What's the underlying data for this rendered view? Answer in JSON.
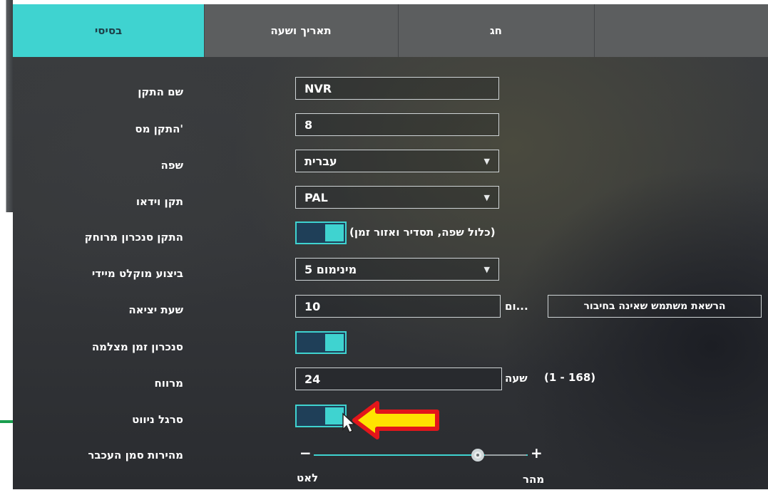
{
  "tabs": [
    {
      "label": "בסיסי",
      "active": true
    },
    {
      "label": "תאריך ושעה",
      "active": false
    },
    {
      "label": "חג",
      "active": false
    },
    {
      "label": "",
      "active": false
    }
  ],
  "rows": {
    "device_name": {
      "label": "שם התקן",
      "value": "NVR"
    },
    "device_no": {
      "label": "'התקן מס",
      "value": "8"
    },
    "language": {
      "label": "שפה",
      "value": "עברית"
    },
    "video_standard": {
      "label": "תקן וידאו",
      "value": "PAL"
    },
    "remote_sync": {
      "label": "התקן סנכרון מרוחק",
      "note": "(כלול שפה, תסדיר ואזור זמן)",
      "on": true
    },
    "instant_playback": {
      "label": "ביצוע מוקלט מיידי",
      "value": "מינימום 5"
    },
    "logout_time": {
      "label": "שעת יציאה",
      "value": "10",
      "unit": "...ום",
      "button": "הרשאת משתמש שאינה בחיבור"
    },
    "camera_time_sync": {
      "label": "סנכרון זמן מצלמה",
      "on": true
    },
    "interval": {
      "label": "מרווח",
      "value": "24",
      "unit": "שעה",
      "range": "(1 - 168)"
    },
    "nav_bar": {
      "label": "סרגל ניווט",
      "on": true
    },
    "mouse_speed": {
      "label": "מהירות סמן העכבר",
      "minus": "−",
      "plus": "+",
      "slow": "לאט",
      "fast": "מהר",
      "level": 0.8
    }
  },
  "colors": {
    "accent": "#3fd3d0",
    "toggle_bg": "#1f3f58",
    "arrow": "#ffe400",
    "arrow_outline": "#e3161b",
    "marker_line": "#1a9e4e"
  },
  "icons": {
    "dropdown": "caret-down-icon",
    "pointer": "mouse-pointer-icon",
    "annotation": "arrow-left-icon"
  }
}
